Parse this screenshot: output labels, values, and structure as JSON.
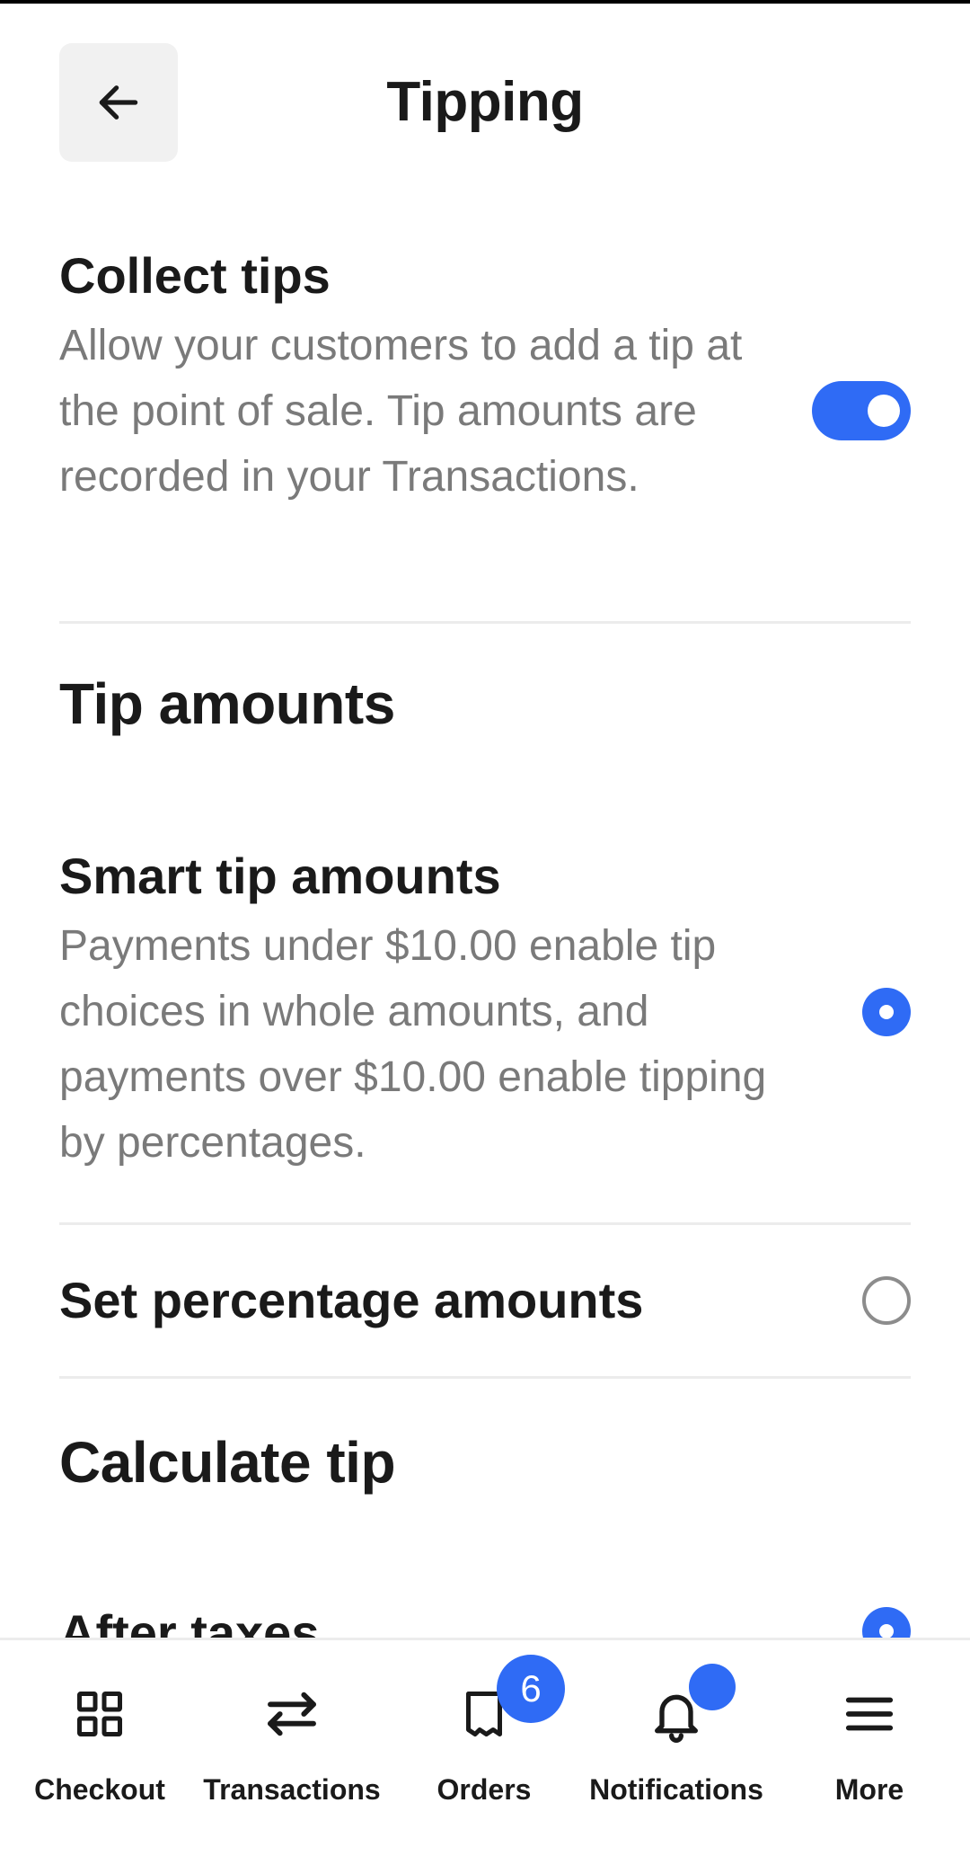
{
  "header": {
    "title": "Tipping",
    "back_icon": "arrow-left-icon"
  },
  "collect_tips": {
    "title": "Collect tips",
    "description": "Allow your customers to add a tip at the point of sale. Tip amounts are recorded in your Transactions.",
    "enabled": true
  },
  "tip_amounts": {
    "heading": "Tip amounts",
    "options": [
      {
        "title": "Smart tip amounts",
        "description": "Payments under $10.00 enable tip choices in whole amounts, and payments over $10.00 enable tipping by percentages.",
        "selected": true
      },
      {
        "title": "Set percentage amounts",
        "selected": false
      }
    ]
  },
  "calculate_tip": {
    "heading": "Calculate tip",
    "options": [
      {
        "title": "After taxes",
        "selected": true
      }
    ]
  },
  "tabbar": {
    "items": [
      {
        "label": "Checkout",
        "icon": "grid-icon"
      },
      {
        "label": "Transactions",
        "icon": "swap-arrows-icon"
      },
      {
        "label": "Orders",
        "icon": "receipt-icon",
        "badge": "6"
      },
      {
        "label": "Notifications",
        "icon": "bell-icon",
        "dot": true
      },
      {
        "label": "More",
        "icon": "menu-icon"
      }
    ]
  },
  "colors": {
    "accent": "#2f6bf5",
    "text": "#1a1a1a",
    "muted": "#7a7a7a",
    "divider": "#ececec"
  }
}
